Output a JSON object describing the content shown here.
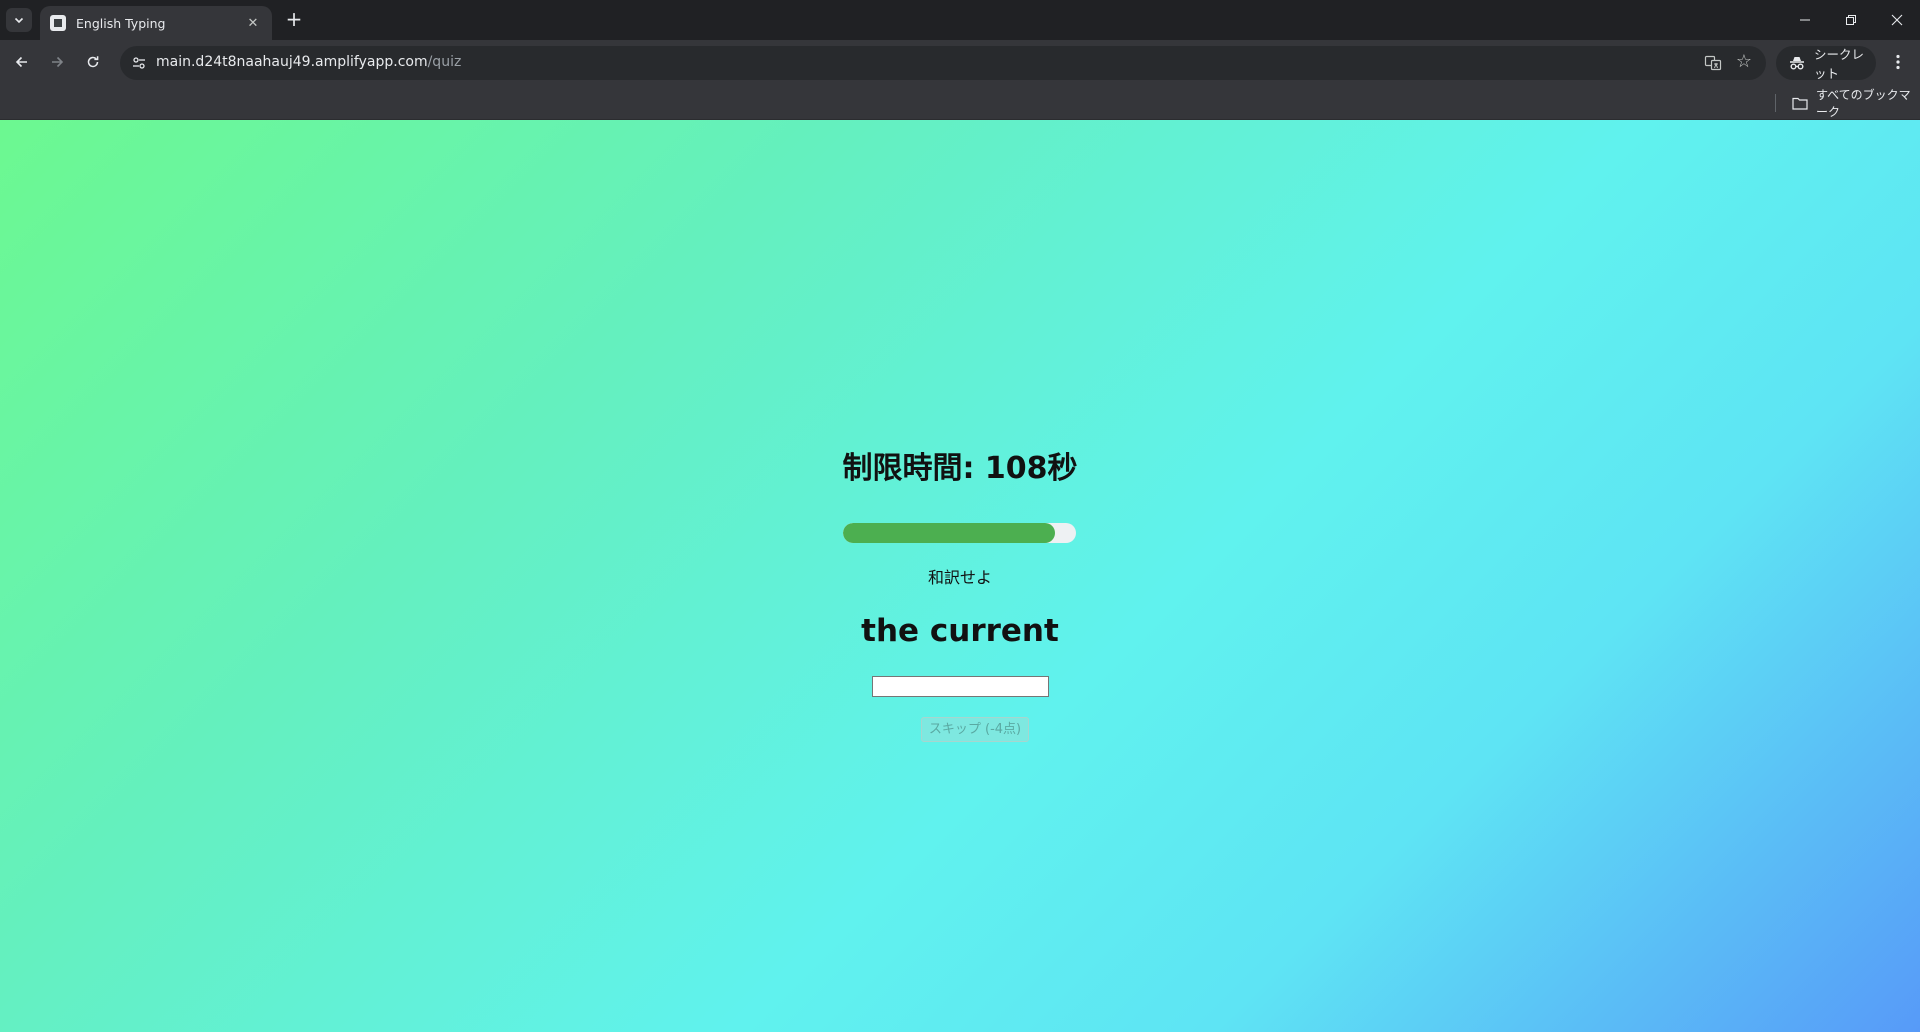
{
  "browser": {
    "tab": {
      "title": "English Typing"
    },
    "address": {
      "host": "main.d24t8naahauj49.amplifyapp.com",
      "path": "/quiz"
    },
    "incognito_label": "シークレット",
    "bookmarks": {
      "all_label": "すべてのブックマーク"
    }
  },
  "quiz": {
    "timer_text": "制限時間: 108秒",
    "progress_percent": 91,
    "instruction": "和訳せよ",
    "word": "the current",
    "answer_value": "",
    "skip_label": "スキップ (-4点)",
    "progress_color": "#4caf50"
  },
  "icons": [
    "tab-search-icon",
    "favicon-icon",
    "close-icon",
    "plus-icon",
    "minimize-icon",
    "restore-icon",
    "window-close-icon",
    "back-arrow-icon",
    "forward-arrow-icon",
    "reload-icon",
    "site-info-icon",
    "translate-icon",
    "star-icon",
    "incognito-icon",
    "more-vert-icon",
    "folder-icon"
  ]
}
